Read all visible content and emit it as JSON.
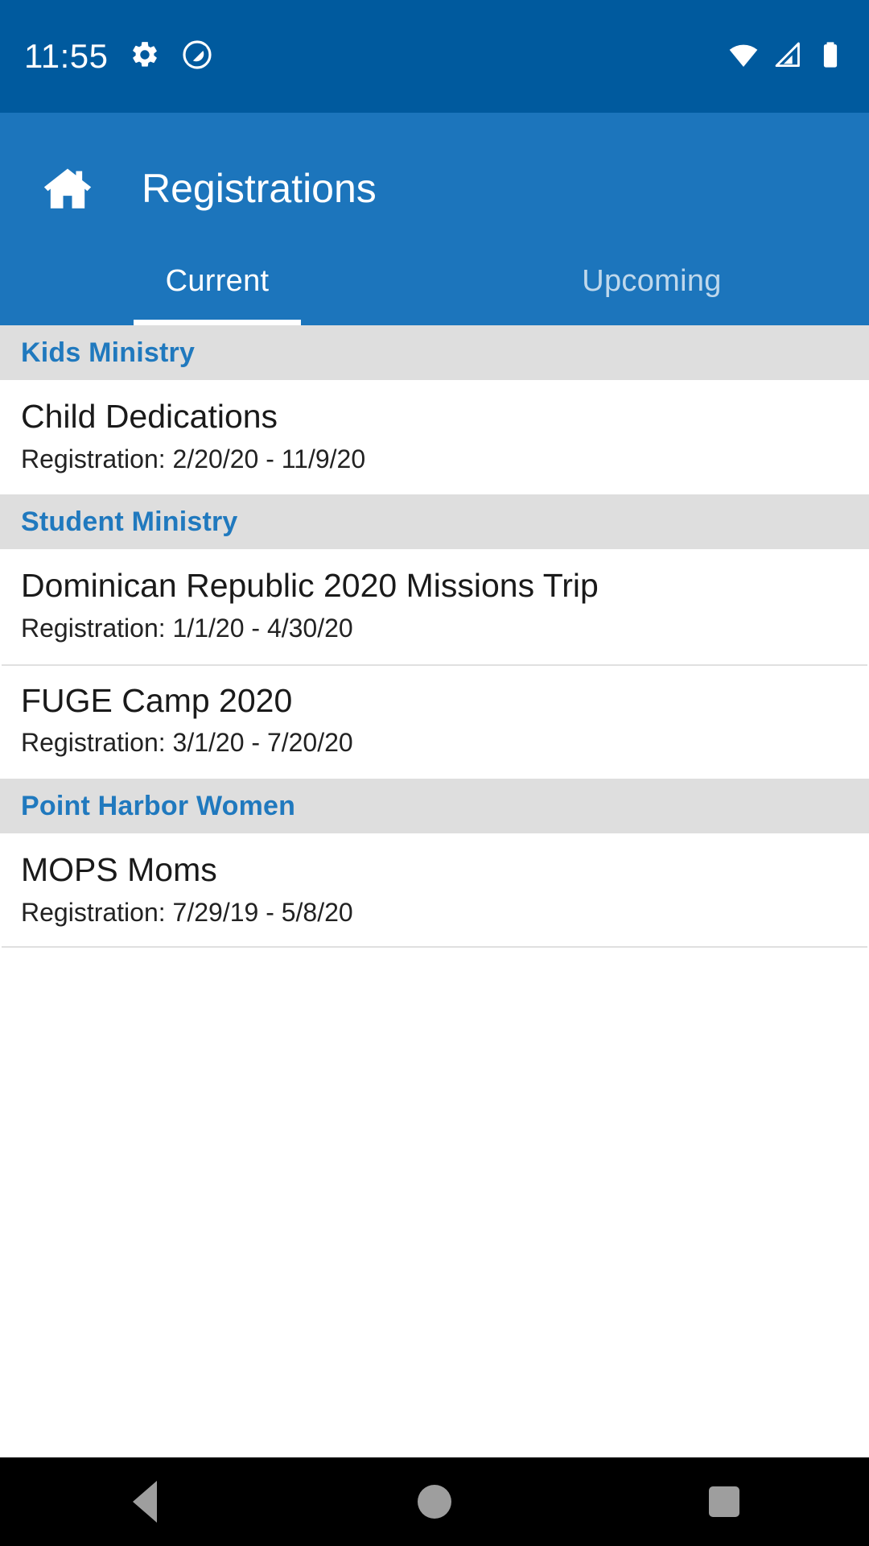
{
  "status_bar": {
    "clock": "11:55",
    "icons": [
      "gear-icon",
      "do-not-disturb-icon"
    ],
    "right_icons": [
      "wifi-icon",
      "cellular-signal-icon",
      "battery-icon"
    ],
    "background_color": "#005a9e"
  },
  "app_bar": {
    "home_icon": "home-icon",
    "title": "Registrations",
    "background_color": "#1c75bc"
  },
  "tabs": [
    {
      "label": "Current",
      "active": true
    },
    {
      "label": "Upcoming",
      "active": false
    }
  ],
  "colors": {
    "accent": "#1c75bc",
    "status_bar": "#005a9e",
    "section_header_text": "#2079be",
    "section_header_bg": "#dedede",
    "divider": "#e0e0e0",
    "nav_bar_bg": "#000000",
    "nav_icon": "#9e9e9e"
  },
  "sections": [
    {
      "title": "Kids Ministry",
      "items": [
        {
          "name": "Child Dedications",
          "registration": "Registration: 2/20/20 - 11/9/20"
        }
      ]
    },
    {
      "title": "Student Ministry",
      "items": [
        {
          "name": "Dominican Republic 2020 Missions Trip",
          "registration": "Registration: 1/1/20 - 4/30/20"
        },
        {
          "name": "FUGE Camp 2020",
          "registration": "Registration: 3/1/20 - 7/20/20"
        }
      ]
    },
    {
      "title": "Point Harbor Women",
      "items": [
        {
          "name": "MOPS Moms",
          "registration": "Registration: 7/29/19 - 5/8/20"
        }
      ]
    }
  ],
  "nav_bar": {
    "back_label": "back-button",
    "home_label": "home-button",
    "recents_label": "recents-button"
  }
}
